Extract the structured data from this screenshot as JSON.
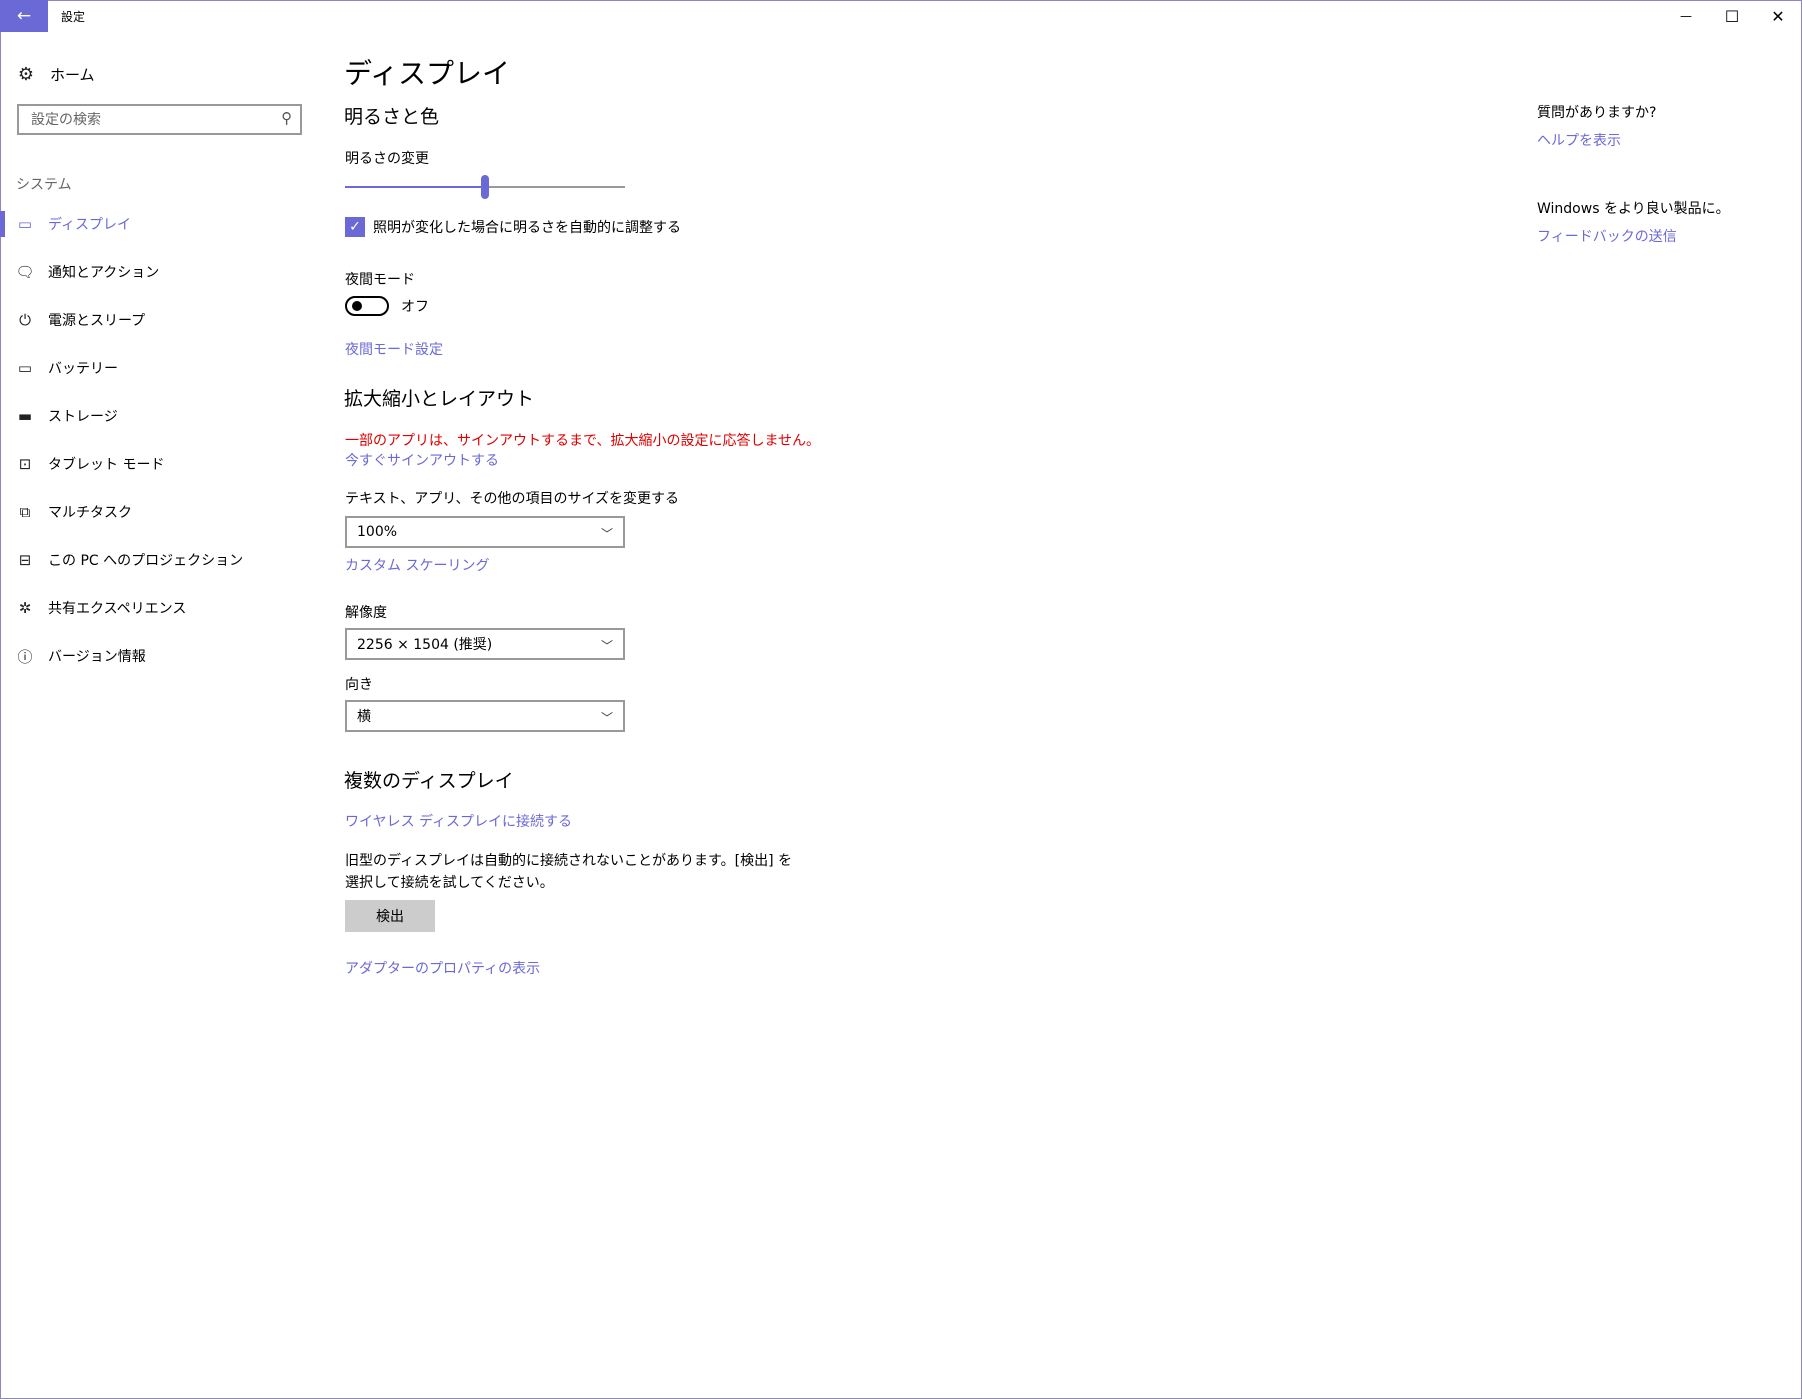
{
  "window": {
    "title": "設定",
    "back_icon": "←",
    "minimize_icon": "—",
    "maximize_icon": "☐",
    "close_icon": "✕",
    "accent_color": "#6b69d6"
  },
  "sidebar": {
    "home_label": "ホーム",
    "home_icon": "⚙",
    "search_placeholder": "設定の検索",
    "search_icon": "⚲",
    "section_label": "システム",
    "items": [
      {
        "label": "ディスプレイ",
        "icon": "display-icon",
        "glyph": "▭",
        "active": true
      },
      {
        "label": "通知とアクション",
        "icon": "notification-icon",
        "glyph": "🗨"
      },
      {
        "label": "電源とスリープ",
        "icon": "power-icon",
        "glyph": "⏻"
      },
      {
        "label": "バッテリー",
        "icon": "battery-icon",
        "glyph": "▭"
      },
      {
        "label": "ストレージ",
        "icon": "storage-icon",
        "glyph": "▬"
      },
      {
        "label": "タブレット モード",
        "icon": "tablet-mode-icon",
        "glyph": "⊡"
      },
      {
        "label": "マルチタスク",
        "icon": "multitask-icon",
        "glyph": "⧉"
      },
      {
        "label": "この PC へのプロジェクション",
        "icon": "projection-icon",
        "glyph": "⊟"
      },
      {
        "label": "共有エクスペリエンス",
        "icon": "shared-experience-icon",
        "glyph": "✲"
      },
      {
        "label": "バージョン情報",
        "icon": "info-icon",
        "glyph": "ⓘ"
      }
    ]
  },
  "main": {
    "page_title": "ディスプレイ",
    "brightness": {
      "heading": "明るさと色",
      "slider_label": "明るさの変更",
      "slider_value": 0.5,
      "auto_checkbox_label": "照明が変化した場合に明るさを自動的に調整する",
      "auto_checked": true,
      "checkmark": "✓"
    },
    "night_mode": {
      "label": "夜間モード",
      "toggle_state": "オフ",
      "settings_link": "夜間モード設定"
    },
    "scale": {
      "heading": "拡大縮小とレイアウト",
      "warning": "一部のアプリは、サインアウトするまで、拡大縮小の設定に応答しません。",
      "signout_link": "今すぐサインアウトする",
      "size_label": "テキスト、アプリ、その他の項目のサイズを変更する",
      "size_value": "100%",
      "custom_link": "カスタム スケーリング",
      "resolution_label": "解像度",
      "resolution_value": "2256 × 1504 (推奨)",
      "orientation_label": "向き",
      "orientation_value": "横",
      "chevron": "﹀"
    },
    "multi": {
      "heading": "複数のディスプレイ",
      "wireless_link": "ワイヤレス ディスプレイに接続する",
      "description": "旧型のディスプレイは自動的に接続されないことがあります。[検出] を選択して接続を試してください。",
      "detect_button": "検出",
      "adapter_link": "アダプターのプロパティの表示"
    }
  },
  "right_pane": {
    "question": "質問がありますか?",
    "help_link": "ヘルプを表示",
    "improve": "Windows をより良い製品に。",
    "feedback_link": "フィードバックの送信"
  }
}
